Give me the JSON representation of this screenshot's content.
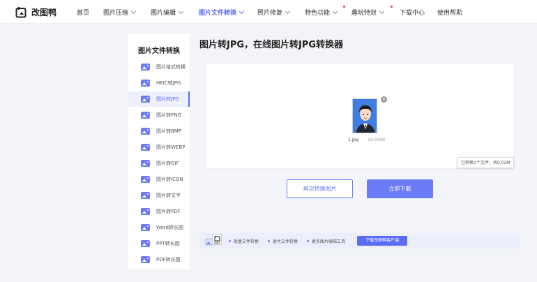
{
  "brand": {
    "name": "改图鸭"
  },
  "nav": [
    {
      "label": "首页",
      "dropdown": false,
      "active": false,
      "dot": false
    },
    {
      "label": "图片压缩",
      "dropdown": true,
      "active": false,
      "dot": false
    },
    {
      "label": "图片编辑",
      "dropdown": true,
      "active": false,
      "dot": false
    },
    {
      "label": "图片文件转换",
      "dropdown": true,
      "active": true,
      "dot": false
    },
    {
      "label": "照片修复",
      "dropdown": true,
      "active": false,
      "dot": false
    },
    {
      "label": "特色功能",
      "dropdown": true,
      "active": false,
      "dot": true
    },
    {
      "label": "趣玩特效",
      "dropdown": true,
      "active": false,
      "dot": true
    },
    {
      "label": "下载中心",
      "dropdown": false,
      "active": false,
      "dot": false
    },
    {
      "label": "使用帮助",
      "dropdown": false,
      "active": false,
      "dot": false
    }
  ],
  "sidebar": {
    "title": "图片文件转换",
    "items": [
      {
        "label": "图片格式转换",
        "icon": "image-format-icon"
      },
      {
        "label": "HEIC转JPG",
        "icon": "heic-icon"
      },
      {
        "label": "图片转JPG",
        "icon": "jpg-icon",
        "active": true
      },
      {
        "label": "图片转PNG",
        "icon": "png-icon"
      },
      {
        "label": "图片转BMP",
        "icon": "bmp-icon"
      },
      {
        "label": "图片转WEBP",
        "icon": "webp-icon"
      },
      {
        "label": "图片转GIF",
        "icon": "gif-icon"
      },
      {
        "label": "图片转ICON",
        "icon": "icon-icon"
      },
      {
        "label": "图片转文字",
        "icon": "text-icon"
      },
      {
        "label": "图片转PDF",
        "icon": "pdf-icon"
      },
      {
        "label": "Word转长图",
        "icon": "word-icon"
      },
      {
        "label": "PPT转长图",
        "icon": "ppt-icon"
      },
      {
        "label": "PDF转长图",
        "icon": "pdf-long-icon"
      }
    ]
  },
  "main": {
    "title": "图片转JPG，在线图片转JPG转换器",
    "file": {
      "name": "1.jpg",
      "size": "19.65KB"
    },
    "status": "已转换1个文件，共0.02M",
    "buttons": {
      "again": "再次转换图片",
      "download": "立即下载"
    }
  },
  "promo": {
    "app_label": "改图鸭",
    "features": [
      "批量文件转换",
      "更大文件转换",
      "更多图片编辑工具"
    ],
    "button": "下载改图鸭客户端"
  },
  "colors": {
    "accent": "#5b6bf5",
    "button": "#6a7cf6"
  }
}
